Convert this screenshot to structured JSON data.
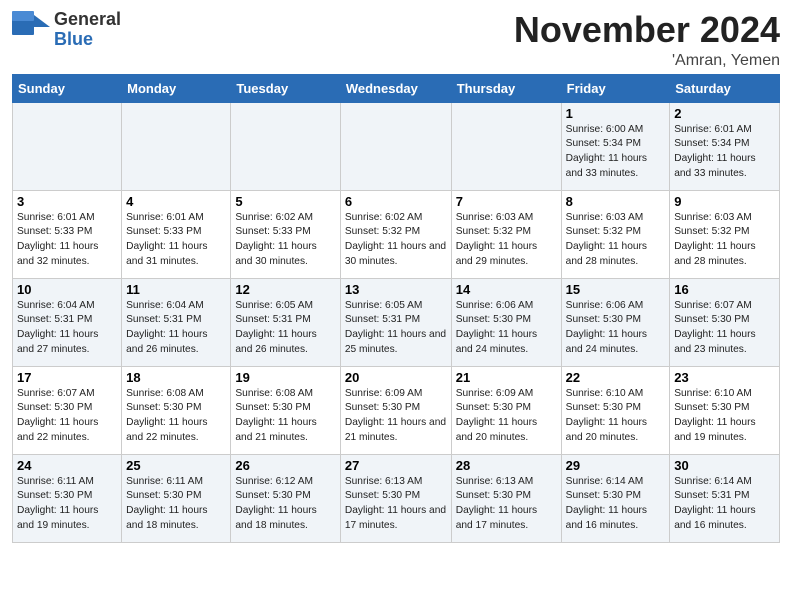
{
  "header": {
    "logo_general": "General",
    "logo_blue": "Blue",
    "month": "November 2024",
    "location": "'Amran, Yemen"
  },
  "weekdays": [
    "Sunday",
    "Monday",
    "Tuesday",
    "Wednesday",
    "Thursday",
    "Friday",
    "Saturday"
  ],
  "rows": [
    [
      {
        "day": "",
        "empty": true
      },
      {
        "day": "",
        "empty": true
      },
      {
        "day": "",
        "empty": true
      },
      {
        "day": "",
        "empty": true
      },
      {
        "day": "",
        "empty": true
      },
      {
        "day": "1",
        "sunrise": "6:00 AM",
        "sunset": "5:34 PM",
        "daylight": "11 hours and 33 minutes."
      },
      {
        "day": "2",
        "sunrise": "6:01 AM",
        "sunset": "5:34 PM",
        "daylight": "11 hours and 33 minutes."
      }
    ],
    [
      {
        "day": "3",
        "sunrise": "6:01 AM",
        "sunset": "5:33 PM",
        "daylight": "11 hours and 32 minutes."
      },
      {
        "day": "4",
        "sunrise": "6:01 AM",
        "sunset": "5:33 PM",
        "daylight": "11 hours and 31 minutes."
      },
      {
        "day": "5",
        "sunrise": "6:02 AM",
        "sunset": "5:33 PM",
        "daylight": "11 hours and 30 minutes."
      },
      {
        "day": "6",
        "sunrise": "6:02 AM",
        "sunset": "5:32 PM",
        "daylight": "11 hours and 30 minutes."
      },
      {
        "day": "7",
        "sunrise": "6:03 AM",
        "sunset": "5:32 PM",
        "daylight": "11 hours and 29 minutes."
      },
      {
        "day": "8",
        "sunrise": "6:03 AM",
        "sunset": "5:32 PM",
        "daylight": "11 hours and 28 minutes."
      },
      {
        "day": "9",
        "sunrise": "6:03 AM",
        "sunset": "5:32 PM",
        "daylight": "11 hours and 28 minutes."
      }
    ],
    [
      {
        "day": "10",
        "sunrise": "6:04 AM",
        "sunset": "5:31 PM",
        "daylight": "11 hours and 27 minutes."
      },
      {
        "day": "11",
        "sunrise": "6:04 AM",
        "sunset": "5:31 PM",
        "daylight": "11 hours and 26 minutes."
      },
      {
        "day": "12",
        "sunrise": "6:05 AM",
        "sunset": "5:31 PM",
        "daylight": "11 hours and 26 minutes."
      },
      {
        "day": "13",
        "sunrise": "6:05 AM",
        "sunset": "5:31 PM",
        "daylight": "11 hours and 25 minutes."
      },
      {
        "day": "14",
        "sunrise": "6:06 AM",
        "sunset": "5:30 PM",
        "daylight": "11 hours and 24 minutes."
      },
      {
        "day": "15",
        "sunrise": "6:06 AM",
        "sunset": "5:30 PM",
        "daylight": "11 hours and 24 minutes."
      },
      {
        "day": "16",
        "sunrise": "6:07 AM",
        "sunset": "5:30 PM",
        "daylight": "11 hours and 23 minutes."
      }
    ],
    [
      {
        "day": "17",
        "sunrise": "6:07 AM",
        "sunset": "5:30 PM",
        "daylight": "11 hours and 22 minutes."
      },
      {
        "day": "18",
        "sunrise": "6:08 AM",
        "sunset": "5:30 PM",
        "daylight": "11 hours and 22 minutes."
      },
      {
        "day": "19",
        "sunrise": "6:08 AM",
        "sunset": "5:30 PM",
        "daylight": "11 hours and 21 minutes."
      },
      {
        "day": "20",
        "sunrise": "6:09 AM",
        "sunset": "5:30 PM",
        "daylight": "11 hours and 21 minutes."
      },
      {
        "day": "21",
        "sunrise": "6:09 AM",
        "sunset": "5:30 PM",
        "daylight": "11 hours and 20 minutes."
      },
      {
        "day": "22",
        "sunrise": "6:10 AM",
        "sunset": "5:30 PM",
        "daylight": "11 hours and 20 minutes."
      },
      {
        "day": "23",
        "sunrise": "6:10 AM",
        "sunset": "5:30 PM",
        "daylight": "11 hours and 19 minutes."
      }
    ],
    [
      {
        "day": "24",
        "sunrise": "6:11 AM",
        "sunset": "5:30 PM",
        "daylight": "11 hours and 19 minutes."
      },
      {
        "day": "25",
        "sunrise": "6:11 AM",
        "sunset": "5:30 PM",
        "daylight": "11 hours and 18 minutes."
      },
      {
        "day": "26",
        "sunrise": "6:12 AM",
        "sunset": "5:30 PM",
        "daylight": "11 hours and 18 minutes."
      },
      {
        "day": "27",
        "sunrise": "6:13 AM",
        "sunset": "5:30 PM",
        "daylight": "11 hours and 17 minutes."
      },
      {
        "day": "28",
        "sunrise": "6:13 AM",
        "sunset": "5:30 PM",
        "daylight": "11 hours and 17 minutes."
      },
      {
        "day": "29",
        "sunrise": "6:14 AM",
        "sunset": "5:30 PM",
        "daylight": "11 hours and 16 minutes."
      },
      {
        "day": "30",
        "sunrise": "6:14 AM",
        "sunset": "5:31 PM",
        "daylight": "11 hours and 16 minutes."
      }
    ]
  ]
}
